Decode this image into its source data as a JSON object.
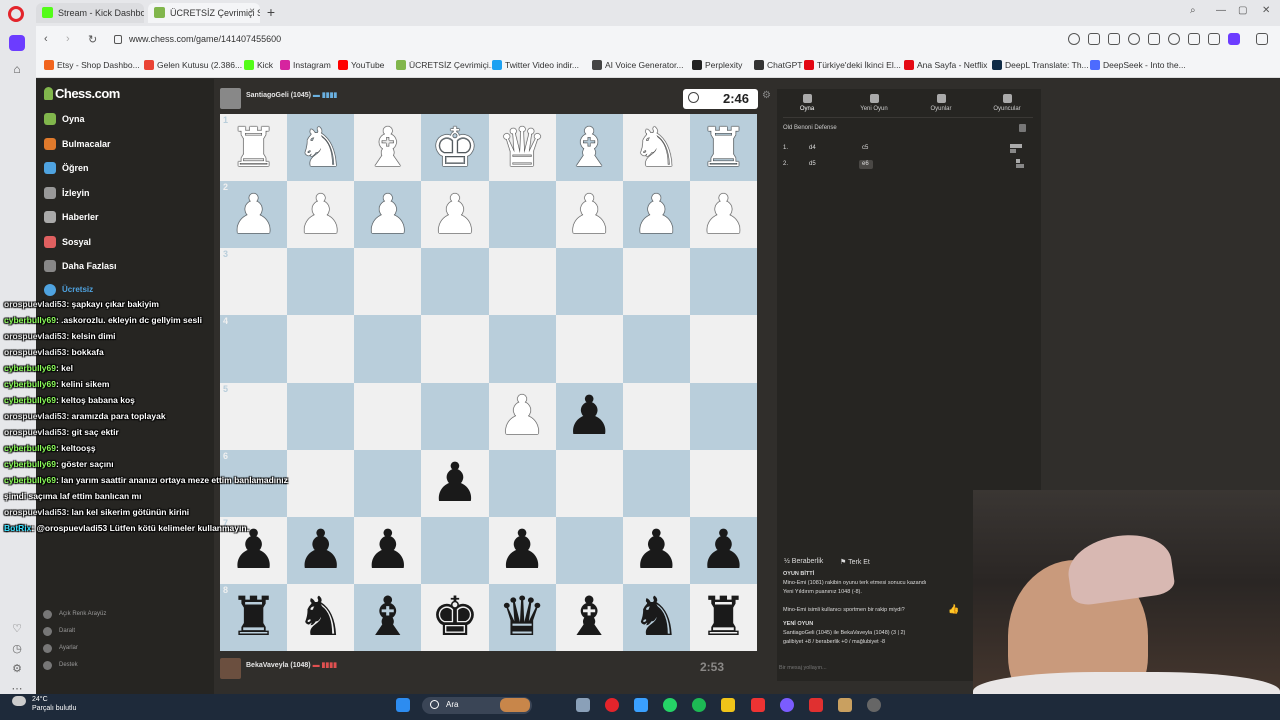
{
  "browser": {
    "tabs": [
      {
        "label": "Stream - Kick Dashboard",
        "color": "#53fc18"
      },
      {
        "label": "ÜCRETSİZ Çevrimiçi Sa",
        "color": "#81b64c"
      }
    ],
    "url": "www.chess.com/game/141407455600",
    "bookmarks": [
      {
        "label": "Etsy - Shop Dashbo...",
        "color": "#f1641e"
      },
      {
        "label": "Gelen Kutusu (2.386...",
        "color": "#ea4335"
      },
      {
        "label": "Kick",
        "color": "#53fc18"
      },
      {
        "label": "Instagram",
        "color": "#d6249f"
      },
      {
        "label": "YouTube",
        "color": "#ff0000"
      },
      {
        "label": "ÜCRETSİZ Çevrimiçi...",
        "color": "#81b64c"
      },
      {
        "label": "Twitter Video indir...",
        "color": "#1da1f2"
      },
      {
        "label": "AI Voice Generator...",
        "color": "#444444"
      },
      {
        "label": "Perplexity",
        "color": "#222222"
      },
      {
        "label": "ChatGPT",
        "color": "#333333"
      },
      {
        "label": "Türkiye'deki İkinci El...",
        "color": "#e30613"
      },
      {
        "label": "Ana Sayfa - Netflix",
        "color": "#e50914"
      },
      {
        "label": "DeepL Translate: Th...",
        "color": "#0f2b46"
      },
      {
        "label": "DeepSeek - Into the...",
        "color": "#4d6bfe"
      }
    ]
  },
  "chess_nav": {
    "logo": "Chess.com",
    "items": [
      {
        "label": "Oyna",
        "color": "#81b64c"
      },
      {
        "label": "Bulmacalar",
        "color": "#e07a2c"
      },
      {
        "label": "Öğren",
        "color": "#4fa3e0"
      },
      {
        "label": "İzleyin",
        "color": "#999999"
      },
      {
        "label": "Haberler",
        "color": "#aaaaaa"
      },
      {
        "label": "Sosyal",
        "color": "#e06060"
      },
      {
        "label": "Daha Fazlası",
        "color": "#888888"
      }
    ],
    "trial": "Ücretsiz",
    "footer": [
      {
        "label": "Açık Renk Arayüz"
      },
      {
        "label": "Daralt"
      },
      {
        "label": "Ayarlar"
      },
      {
        "label": "Destek"
      }
    ]
  },
  "game": {
    "top_player": "SantiagoGeli (1045)",
    "bottom_player": "BekaVaveyla (1048)",
    "top_clock": "2:46",
    "bottom_clock": "2:53",
    "board": [
      [
        "wR",
        "wN",
        "wB",
        "wK",
        "wQ",
        "wB",
        "wN",
        "wR"
      ],
      [
        "wP",
        "wP",
        "wP",
        "wP",
        "",
        "wP",
        "wP",
        "wP"
      ],
      [
        "",
        "",
        "",
        "",
        "",
        "",
        "",
        ""
      ],
      [
        "",
        "",
        "",
        "",
        "",
        "",
        "",
        ""
      ],
      [
        "",
        "",
        "",
        "",
        "wP",
        "bP",
        "",
        ""
      ],
      [
        "",
        "",
        "",
        "bP",
        "",
        "",
        "",
        ""
      ],
      [
        "bP",
        "bP",
        "bP",
        "",
        "bP",
        "",
        "bP",
        "bP"
      ],
      [
        "bR",
        "bN",
        "bB",
        "bK",
        "bQ",
        "bB",
        "bN",
        "bR"
      ]
    ],
    "rank_labels": [
      "1",
      "2",
      "3",
      "4",
      "5",
      "6",
      "7",
      "8"
    ]
  },
  "right_panel": {
    "tabs": [
      "Oyna",
      "Yeni Oyun",
      "Oyunlar",
      "Oyuncular"
    ],
    "opening": "Old Benoni Defense",
    "moves": [
      {
        "num": "1.",
        "white": "d4",
        "black": "c5"
      },
      {
        "num": "2.",
        "white": "d5",
        "black": "e6"
      }
    ],
    "draw_label": "Beraberlik",
    "resign_label": "Terk Et",
    "game_over_title": "OYUN BİTTİ",
    "game_over_text": "Mino-Emi (1081) rakibin oyunu terk etmesi sonucu kazandı",
    "rating_text": "Yeni Yıldırım puanınız 1048 (-8).",
    "rematch_text": "Mino-Emi isimli kullanıcı sportmen bir rakip miydi?",
    "new_game_title": "YENİ OYUN",
    "new_game_text": "SantiagoGeli (1045) ile BekaVaveyla (1048) (3 | 2)",
    "score_text": "galibiyet +8 / beraberlik +0 / mağlubiyet -8",
    "message_placeholder": "Bir mesaj yollayın..."
  },
  "chat": [
    {
      "user": "orospuevladi53",
      "text": ": şapkayı çıkar bakiyim",
      "style": "u1"
    },
    {
      "user": "cyberbully69",
      "text": ": .askorozlu. ekleyin dc gellyim sesli",
      "style": "u2"
    },
    {
      "user": "orospuevladi53",
      "text": ": kelsin dimi",
      "style": "u1"
    },
    {
      "user": "orospuevladi53",
      "text": ": bokkafa",
      "style": "u1"
    },
    {
      "user": "cyberbully69",
      "text": ": kel",
      "style": "u2"
    },
    {
      "user": "cyberbully69",
      "text": ": kelini sikem",
      "style": "u2"
    },
    {
      "user": "cyberbully69",
      "text": ": keltoş babana koş",
      "style": "u2"
    },
    {
      "user": "orospuevladi53",
      "text": ": aramızda para toplayak",
      "style": "u1"
    },
    {
      "user": "orospuevladi53",
      "text": ": git saç ektir",
      "style": "u1"
    },
    {
      "user": "cyberbully69",
      "text": ": keltooşş",
      "style": "u2"
    },
    {
      "user": "cyberbully69",
      "text": ": göster saçını",
      "style": "u2"
    },
    {
      "user": "cyberbully69",
      "text": ": lan yarım saattir ananızı ortaya meze ettim banlamadınız",
      "style": "u2"
    },
    {
      "user": "",
      "text": "şimdi saçıma laf ettim banlıcan mı",
      "style": "u1"
    },
    {
      "user": "orospuevladi53",
      "text": ": lan kel sikerim götünün kirini",
      "style": "u1"
    },
    {
      "user": "BotRix",
      "text": ": @orospuevladi53 Lütfen kötü kelimeler kullanmayın.",
      "style": "u3"
    }
  ],
  "taskbar": {
    "weather_temp": "24°C",
    "weather_desc": "Parçalı bulutlu",
    "search": "Ara"
  }
}
